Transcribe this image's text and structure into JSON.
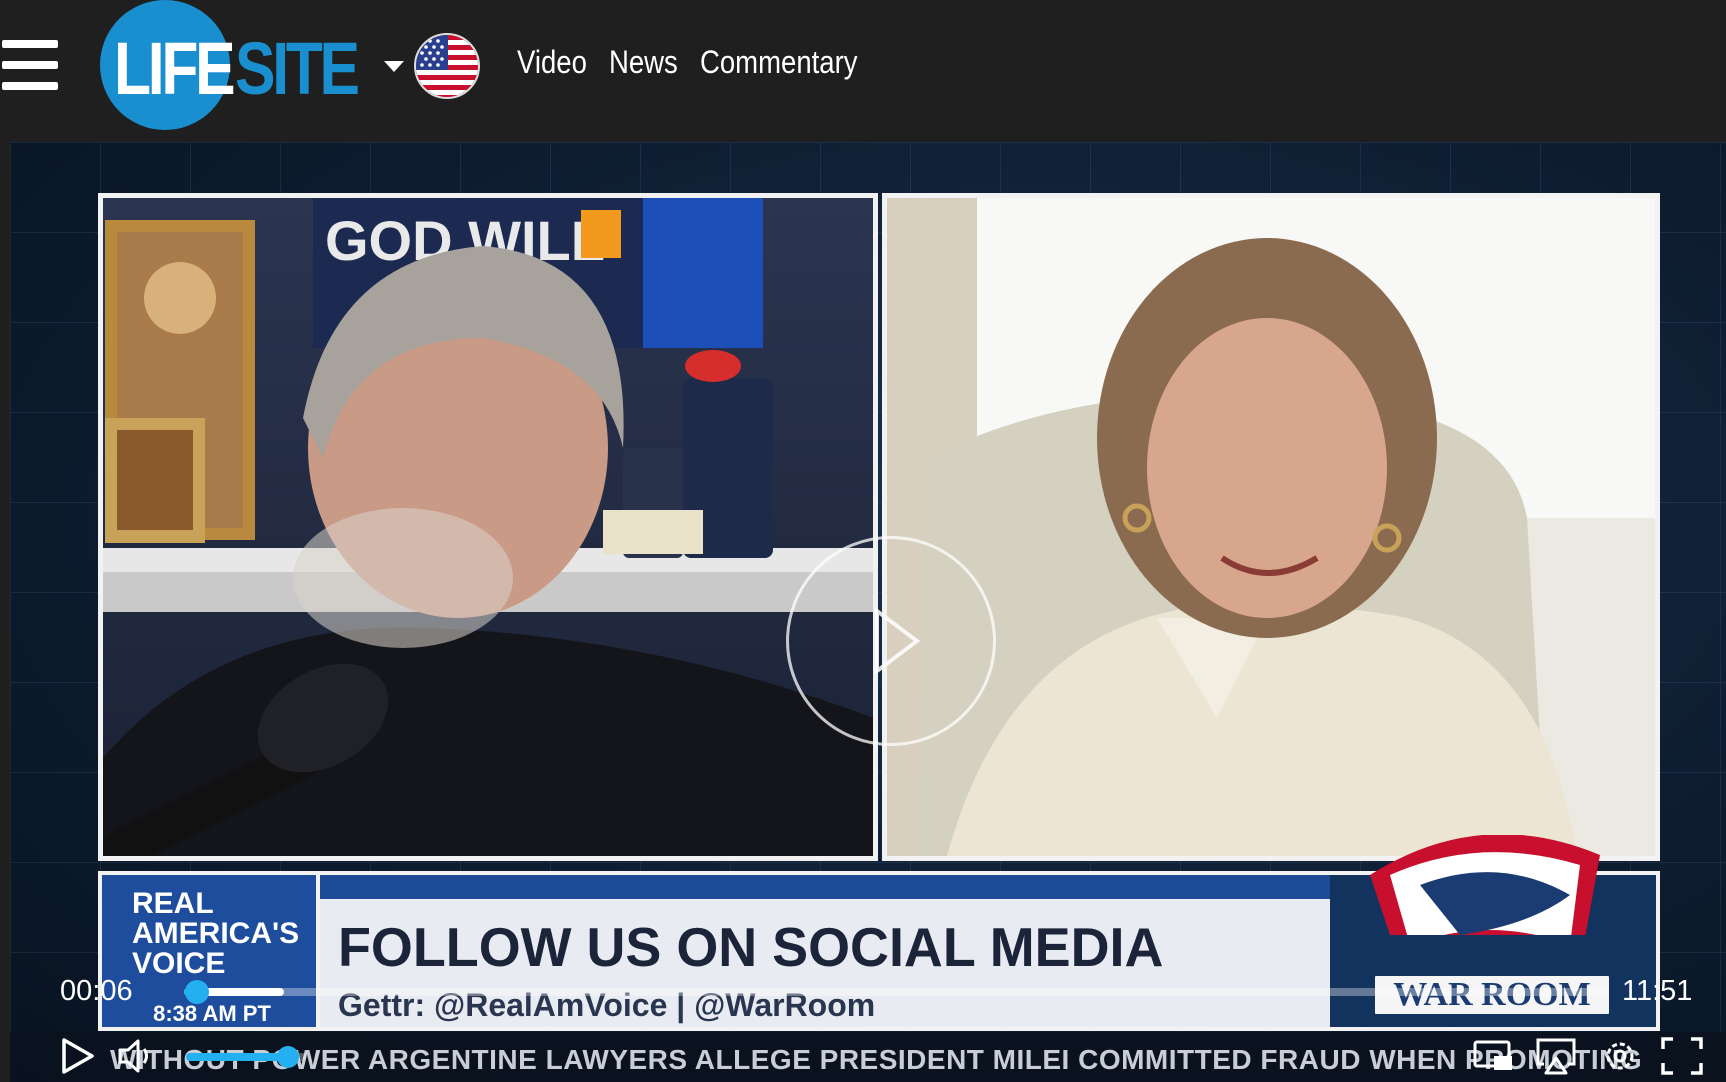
{
  "header": {
    "logo_part1": "LIFE",
    "logo_part2": "SITE",
    "brand_color": "#1a8fd0",
    "region_icon": "us-flag-icon",
    "nav": [
      {
        "label": "Video"
      },
      {
        "label": "News"
      },
      {
        "label": "Commentary"
      }
    ]
  },
  "video": {
    "overlay": {
      "rav_line1": "REAL",
      "rav_line2": "AMERICA'S",
      "rav_line3": "VOICE",
      "rav_time": "8:38 AM PT",
      "headline": "FOLLOW US ON SOCIAL MEDIA",
      "subline": "Gettr: @RealAmVoice  |  @WarRoom",
      "warroom_label": "WAR ROOM",
      "backdrop_sign": "GOD WILL",
      "ticker": "WITHOUT POWER     ARGENTINE LAWYERS ALLEGE PRESIDENT MILEI COMMITTED FRAUD WHEN PROMOTING"
    },
    "controls": {
      "current_time": "00:06",
      "duration": "11:51",
      "played_fraction": 0.009,
      "buffered_fraction": 0.07,
      "volume_fraction": 0.85,
      "accent_color": "#24b0f0",
      "icons": [
        "play-icon",
        "volume-icon",
        "picture-in-picture-icon",
        "airplay-icon",
        "settings-icon",
        "fullscreen-icon"
      ]
    }
  }
}
